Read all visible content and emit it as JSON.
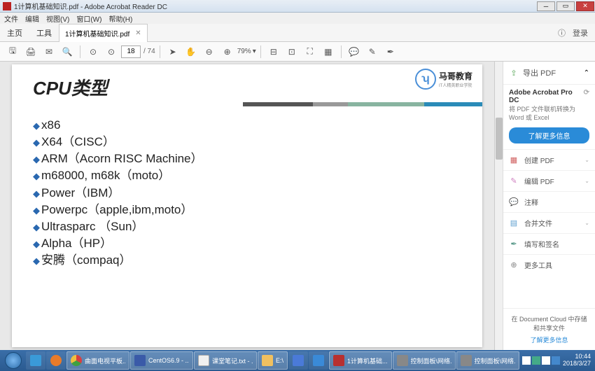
{
  "title_bar": "1计算机基础知识.pdf - Adobe Acrobat Reader DC",
  "menu": [
    "文件",
    "编辑",
    "视图(V)",
    "窗口(W)",
    "帮助(H)"
  ],
  "tabs": {
    "home": "主页",
    "tools": "工具",
    "doc": "1计算机基础知识.pdf",
    "login": "登录"
  },
  "toolbar": {
    "page_current": "18",
    "page_total": "/ 74",
    "zoom": "79%"
  },
  "slide": {
    "title": "CPU类型",
    "logo_main": "马哥教育",
    "logo_sub": "IT人精英职业学院",
    "bullets": [
      "x86",
      "X64（CISC）",
      "ARM（Acorn RISC Machine）",
      "m68000, m68k（moto）",
      "Power（IBM）",
      "Powerpc（apple,ibm,moto）",
      "Ultrasparc （Sun）",
      "Alpha（HP）",
      "安腾（compaq）"
    ]
  },
  "side": {
    "export": "导出 PDF",
    "product": "Adobe Acrobat Pro DC",
    "desc": "将 PDF 文件联机转换为 Word 或 Excel",
    "learn_more": "了解更多信息",
    "items": [
      "创建 PDF",
      "编辑 PDF",
      "注释",
      "合并文件",
      "填写和签名",
      "更多工具"
    ],
    "footer": "在 Document Cloud 中存储和共享文件",
    "footer_link": "了解更多信息"
  },
  "taskbar": {
    "apps": [
      {
        "label": "曲面电视平板..."
      },
      {
        "label": "CentOS6.9 - ..."
      },
      {
        "label": "课堂笔记.txt - ..."
      },
      {
        "label": "E:\\"
      },
      {
        "label": "1计算机基础..."
      },
      {
        "label": "控制面板\\网络..."
      },
      {
        "label": "控制面板\\网络..."
      }
    ],
    "time": "10:44",
    "date": "2018/3/27"
  }
}
